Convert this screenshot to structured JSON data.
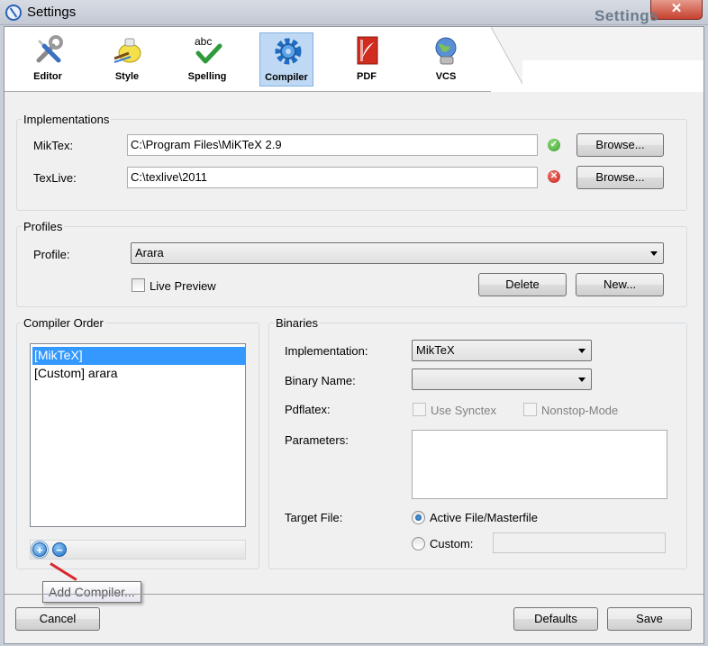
{
  "window": {
    "title": "Settings",
    "close_glyph": "✕"
  },
  "header": {
    "title": "Settings"
  },
  "toolbar": [
    {
      "id": "editor",
      "label": "Editor",
      "icon": "wrench-screwdriver-icon"
    },
    {
      "id": "style",
      "label": "Style",
      "icon": "palette-icon"
    },
    {
      "id": "spelling",
      "label": "Spelling",
      "icon": "abc-check-icon",
      "icon_text": "abc"
    },
    {
      "id": "compiler",
      "label": "Compiler",
      "icon": "gear-icon",
      "active": true
    },
    {
      "id": "pdf",
      "label": "PDF",
      "icon": "pdf-icon"
    },
    {
      "id": "vcs",
      "label": "VCS",
      "icon": "globe-icon"
    }
  ],
  "implementations": {
    "legend": "Implementations",
    "miktex": {
      "label": "MikTex:",
      "path": "C:\\Program Files\\MiKTeX 2.9",
      "status": "ok",
      "browse": "Browse..."
    },
    "texlive": {
      "label": "TexLive:",
      "path": "C:\\texlive\\2011",
      "status": "error",
      "browse": "Browse..."
    }
  },
  "profiles": {
    "legend": "Profiles",
    "profile_label": "Profile:",
    "profile_value": "Arara",
    "live_preview": "Live Preview",
    "delete": "Delete",
    "new": "New..."
  },
  "compiler_order": {
    "legend": "Compiler Order",
    "items": [
      "[MikTeX]",
      "[Custom] arara"
    ],
    "selected_index": 0,
    "add_glyph": "+",
    "remove_glyph": "−",
    "tooltip": "Add Compiler..."
  },
  "binaries": {
    "legend": "Binaries",
    "implementation_label": "Implementation:",
    "implementation_value": "MikTeX",
    "binary_name_label": "Binary Name:",
    "binary_name_value": "",
    "pdflatex_label": "Pdflatex:",
    "use_synctex": "Use Synctex",
    "nonstop_mode": "Nonstop-Mode",
    "parameters_label": "Parameters:",
    "parameters_value": "",
    "target_file_label": "Target File:",
    "active_file": "Active File/Masterfile",
    "custom": "Custom:",
    "custom_value": ""
  },
  "footer": {
    "cancel": "Cancel",
    "defaults": "Defaults",
    "save": "Save"
  },
  "colors": {
    "ok": "#4fb040",
    "error": "#d9302c",
    "selection": "#3399ff",
    "active_tab": "#bfd9f4"
  }
}
